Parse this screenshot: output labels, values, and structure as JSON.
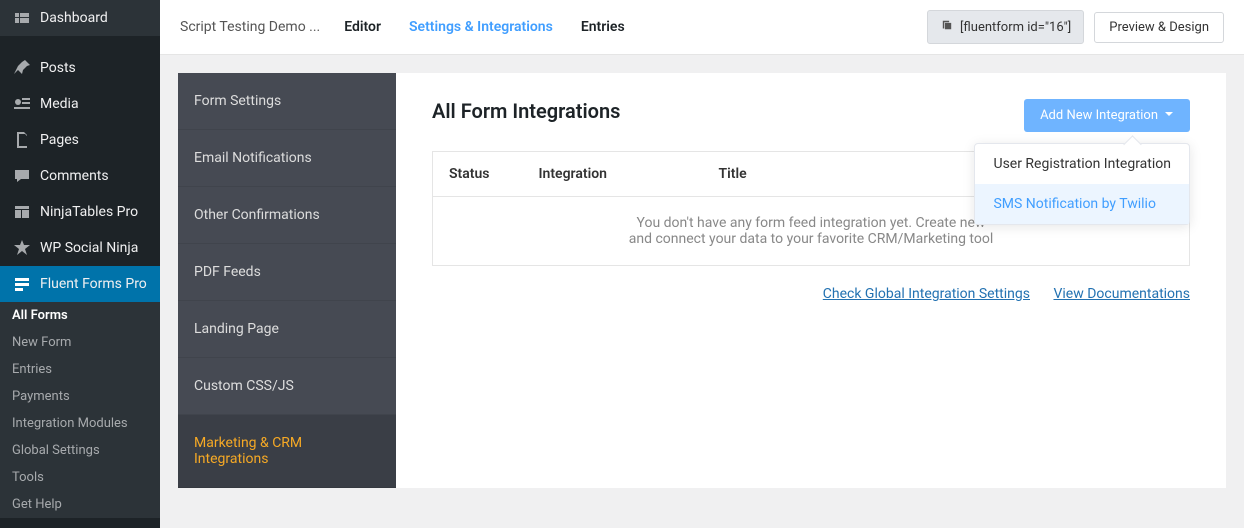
{
  "wp_menu": {
    "dashboard": "Dashboard",
    "posts": "Posts",
    "media": "Media",
    "pages": "Pages",
    "comments": "Comments",
    "ninjatables": "NinjaTables Pro",
    "wpsocial": "WP Social Ninja",
    "fluentforms": "Fluent Forms Pro"
  },
  "ff_submenu": {
    "all_forms": "All Forms",
    "new_form": "New Form",
    "entries": "Entries",
    "payments": "Payments",
    "integration_modules": "Integration Modules",
    "global_settings": "Global Settings",
    "tools": "Tools",
    "get_help": "Get Help"
  },
  "topnav": {
    "form_name": "Script Testing Demo ...",
    "editor": "Editor",
    "settings": "Settings & Integrations",
    "entries": "Entries",
    "shortcode": "[fluentform id=\"16\"]",
    "preview": "Preview & Design"
  },
  "settings_menu": {
    "form_settings": "Form Settings",
    "email_notifications": "Email Notifications",
    "other_confirmations": "Other Confirmations",
    "pdf_feeds": "PDF Feeds",
    "landing_page": "Landing Page",
    "custom_css": "Custom CSS/JS",
    "marketing": "Marketing & CRM Integrations"
  },
  "content": {
    "title": "All Form Integrations",
    "add_btn": "Add New Integration",
    "col_status": "Status",
    "col_integration": "Integration",
    "col_title": "Title",
    "empty_line1": "You don't have any form feed integration yet. Create new",
    "empty_line2": "and connect your data to your favorite CRM/Marketing tool",
    "link_global": "Check Global Integration Settings",
    "link_docs": "View Documentations"
  },
  "dropdown": {
    "user_reg": "User Registration Integration",
    "sms": "SMS Notification by Twilio"
  }
}
